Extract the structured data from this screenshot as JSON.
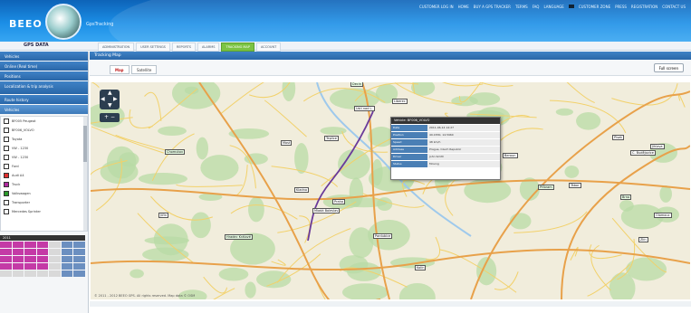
{
  "header": {
    "brand": "BEEO",
    "brand_sub": "GpsTracking",
    "top_links": [
      "CUSTOMER LOG IN",
      "HOME",
      "BUY A GPS TRACKER",
      "TERMS",
      "FAQ",
      "LANGUAGE",
      "CUSTOMER ZONE",
      "PRESS",
      "REGISTRATION",
      "CONTACT US"
    ]
  },
  "nav": {
    "label": "GPS DATA",
    "items": [
      "ADMINISTRATION",
      "USER SETTINGS",
      "REPORTS",
      "ALARMS",
      "TRACKING MAP",
      "ACCOUNT"
    ],
    "active_index": 4
  },
  "sidebar": {
    "menu": [
      "Vehicles",
      "Online (Real time)",
      "Positions",
      "Localization & trip analysis",
      "Route history"
    ],
    "section_title": "Vehicles",
    "vehicles": [
      {
        "label": "BF005 Peugeot",
        "color": "#ffffff"
      },
      {
        "label": "BF006_VOLVO",
        "color": "#ffffff"
      },
      {
        "label": "Toyota",
        "color": "#ffffff"
      },
      {
        "label": "VW - 1230",
        "color": "#ffffff"
      },
      {
        "label": "VW - 1230",
        "color": "#ffffff"
      },
      {
        "label": "Ford",
        "color": "#ffffff"
      },
      {
        "label": "Audi A4",
        "color": "#e03030"
      },
      {
        "label": "Truck",
        "color": "#b02aa0"
      },
      {
        "label": "Volkswagen",
        "color": "#2a9a2a"
      },
      {
        "label": "Transporter",
        "color": "#ffffff"
      },
      {
        "label": "Mercedes Sprinter",
        "color": "#ffffff"
      }
    ],
    "calendar_title": "2011"
  },
  "content": {
    "title": "Tracking Map",
    "tabs": [
      "Map",
      "Satellite"
    ],
    "active_tab": 0,
    "fullscreen_label": "Full screen",
    "popup": {
      "title": "Vehicle: BF006_VOLVO",
      "rows": [
        {
          "k": "Date",
          "v": "2011-06-14 14:27"
        },
        {
          "k": "Position",
          "v": "49.1830, 14.5960"
        },
        {
          "k": "Speed",
          "v": "48 km/h"
        },
        {
          "k": "Address",
          "v": "Prague, Czech Republic"
        },
        {
          "k": "Driver",
          "v": "John Smith"
        },
        {
          "k": "Status",
          "v": "Moving"
        }
      ]
    },
    "copyright": "© 2011 - 2012 BEEO GPS. All rights reserved. Map data © OSM"
  },
  "map": {
    "cities": [
      "Decin",
      "Liberec",
      "Ústí nad L.",
      "Most",
      "Teplice",
      "Chomutov",
      "Kladno",
      "Praha",
      "Mladá Boleslav",
      "Jičín",
      "Hradec Králové",
      "Pardubice",
      "Kolín",
      "Plzeň",
      "Beroun",
      "Příbram",
      "Tábor",
      "Písek",
      "Č. Budějovice",
      "Jihlava",
      "Brno",
      "Zlín",
      "Olomouc"
    ],
    "colors": {
      "land": "#f1eddc",
      "forest": "#b8dba6",
      "road_major": "#e8a14a",
      "road_minor": "#f2d16a",
      "route": "#6a3a9a",
      "water": "#9ec9ec"
    }
  }
}
